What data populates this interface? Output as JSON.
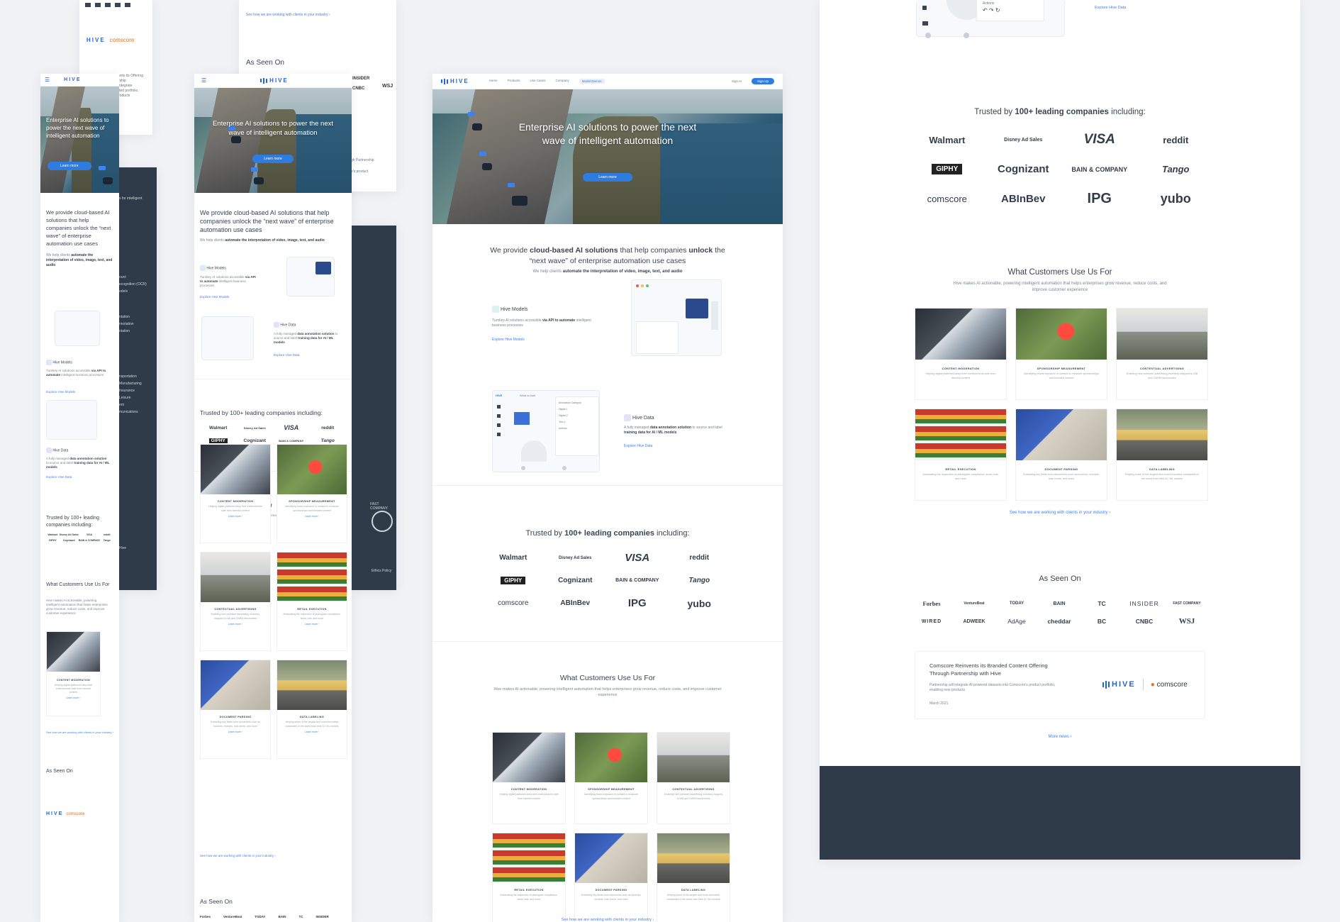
{
  "brand": {
    "logo_text": "HIVE",
    "accent": "#2f7ce0",
    "dark": "#2f3b48"
  },
  "nav": {
    "links": [
      "Home",
      "Products",
      "Use Cases",
      "Company",
      "Model Demos"
    ],
    "sign_in": "Sign In",
    "sign_up": "Sign Up"
  },
  "hero": {
    "headline": "Enterprise AI solutions to power the next wave of intelligent automation",
    "cta": "Learn more"
  },
  "intro": {
    "lead_1": "We provide ",
    "lead_bold_1": "cloud-based AI solutions",
    "lead_2": " that help companies ",
    "lead_bold_2": "unlock",
    "lead_3": " the “next wave” of enterprise automation use cases",
    "sub_1": "We help clients ",
    "sub_bold": "automate the interpretation of video, image, text, and audio"
  },
  "models": {
    "title": "Hive Models",
    "desc_1": "Turnkey AI solutions accessible ",
    "desc_bold": "via API to automate",
    "desc_2": " intelligent business processes",
    "link": "Explore Hive Models"
  },
  "data_product": {
    "title": "Hive Data",
    "desc_1": "A fully managed ",
    "desc_bold_1": "data annotation solution",
    "desc_2": " to source and label ",
    "desc_bold_2": "training data for AI / ML models",
    "link": "Explore Hive Data"
  },
  "mock_ui": {
    "actions": "Actions",
    "what_to_look": "What to look",
    "annotation_category": "Annotation Category",
    "digital_1": "Digital 1",
    "digital_2": "Digital 2",
    "text_1": "Text 1"
  },
  "trusted": {
    "title_1": "Trusted by ",
    "title_bold": "100+ leading companies",
    "title_2": " including:",
    "logos": [
      "Walmart",
      "Disney Ad Sales",
      "VISA",
      "reddit",
      "GIPHY",
      "Cognizant",
      "BAIN & COMPANY",
      "Tango",
      "comscore",
      "ABInBev",
      "IPG",
      "yubo"
    ]
  },
  "uses": {
    "title": "What Customers Use Us For",
    "subtitle": "Hive makes AI actionable, powering intelligent automation that helps enterprises grow revenue, reduce costs, and improve customer experience",
    "items": [
      {
        "title": "CONTENT MODERATION",
        "desc": "Helping digital platforms keep their environments safe from harmful content"
      },
      {
        "title": "SPONSORSHIP MEASUREMENT",
        "desc": "Identifying brand exposure in content to measure sponsorships and branded content"
      },
      {
        "title": "CONTEXTUAL ADVERTISING",
        "desc": "Enabling new premium advertising inventory mapped to IAB and GARM taxonomies"
      },
      {
        "title": "RETAIL EXECUTION",
        "desc": "Automating the inspection of planogram compliance, stock outs, and more"
      },
      {
        "title": "DOCUMENT PARSING",
        "desc": "Extracting key fields from documents such as invoices, receipts, loan forms, and more"
      },
      {
        "title": "DATA LABELING",
        "desc": "Helping some of the largest and most innovative companies in the world train their AI / ML models"
      }
    ],
    "learn_more": "Learn more ›",
    "industry_link": "See how we are working with clients in your industry ›"
  },
  "seen_on": {
    "title": "As Seen On",
    "logos": [
      "Forbes",
      "VentureBeat",
      "TODAY",
      "BAIN",
      "TC",
      "INSIDER",
      "FAST COMPANY",
      "WIRED",
      "ADWEEK",
      "AdAge",
      "cheddar",
      "BC",
      "CNBC",
      "WSJ"
    ]
  },
  "news": {
    "headline": "Comscore Reinvents its Branded Content Offering Through Partnership with Hive",
    "desc": "Partnership will integrate AI-powered datasets into Comscore's product portfolio, enabling new products",
    "date": "March 2021",
    "partner": "comscore",
    "more": "More news ›"
  },
  "sidebar_dark": {
    "items_1": [
      "s for intelligent"
    ],
    "items_2": [
      "ount",
      "ecognition (OCR)",
      "odels"
    ],
    "items_3": [
      "ntation",
      "nnotation",
      "otation"
    ],
    "items_4": [
      "nsportation",
      "Manufacturing",
      "Insurance",
      "Leisure",
      "ent",
      "munications"
    ],
    "fastco": "FAST COMPANY",
    "policy": "Ethics Policy",
    "hive": "Hive"
  },
  "misc": {
    "partnership": "gh Partnership",
    "product": "e's product",
    "seen_small": "See how we are working with clients in your industry ›",
    "offering": "ents its Offering",
    "partnership2": "rship",
    "integrate": "integrate",
    "portfolio": "ited portfolio,",
    "products": "roducts"
  }
}
